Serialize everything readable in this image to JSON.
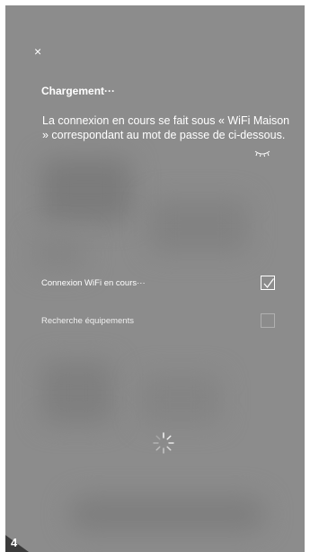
{
  "dialog": {
    "close_label": "×",
    "title": "Chargement···",
    "description": "La connexion en cours se fait sous « WiFi Maison » correspondant au mot de passe de ci-dessous."
  },
  "icons": {
    "close": "close-icon",
    "eye": "eye-closed-icon",
    "spinner": "loading-spinner-icon",
    "check": "checkmark-icon"
  },
  "steps": [
    {
      "label": "Connexion WiFi en cours···",
      "checked": true
    },
    {
      "label": "Recherche équipements",
      "checked": false
    }
  ],
  "step_number": "4",
  "colors": {
    "overlay": "#8c8c8c",
    "text": "#ffffff",
    "badge": "#3b3b3b"
  }
}
